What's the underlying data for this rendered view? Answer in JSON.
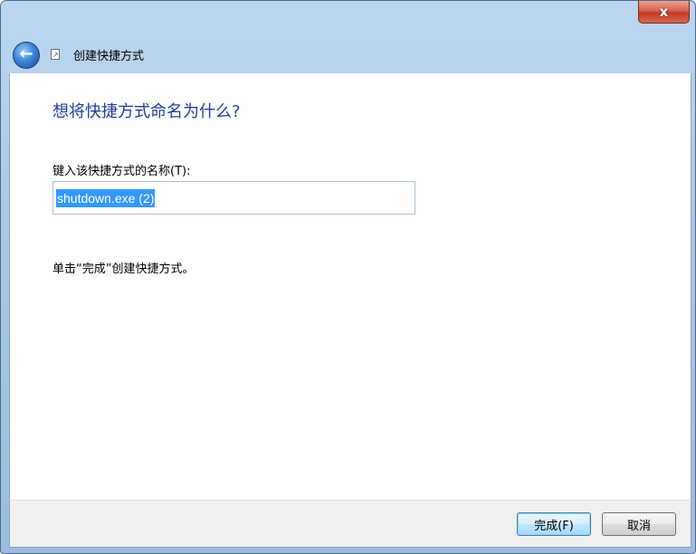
{
  "window": {
    "title": "创建快捷方式",
    "close_glyph": "x",
    "back_glyph": "←"
  },
  "icons": {
    "close": "close-icon",
    "back": "back-arrow-icon",
    "app": "shortcut-icon"
  },
  "main": {
    "heading": "想将快捷方式命名为什么?",
    "field_label": "键入该快捷方式的名称(T):",
    "input_value": "shutdown.exe (2)",
    "hint": "单击“完成”创建快捷方式。"
  },
  "footer": {
    "finish_label": "完成(F)",
    "cancel_label": "取消"
  },
  "colors": {
    "heading": "#1f3e9c",
    "selection": "#3399ff",
    "close_button": "#c23a22"
  }
}
